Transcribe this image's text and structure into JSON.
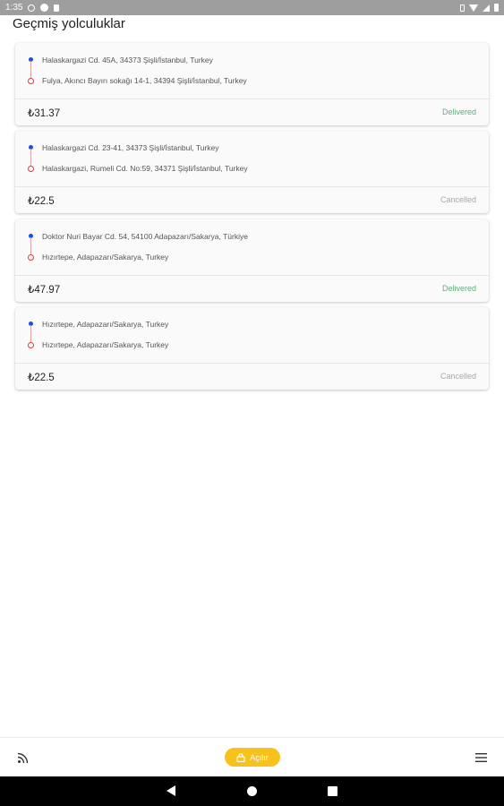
{
  "status_bar": {
    "time": "1:35"
  },
  "page": {
    "title": "Geçmiş yolculuklar"
  },
  "trips": [
    {
      "from": "Halaskargazi Cd. 45A, 34373 Şişli/İstanbul, Turkey",
      "to": "Fulya, Akıncı Bayırı sokağı 14-1, 34394 Şişli/İstanbul, Turkey",
      "price": "₺31.37",
      "status": "Delivered"
    },
    {
      "from": "Halaskargazi Cd. 23-41, 34373 Şişli/İstanbul, Turkey",
      "to": "Halaskargazi, Rumeli Cd. No:59, 34371 Şişli/İstanbul, Turkey",
      "price": "₺22.5",
      "status": "Cancelled"
    },
    {
      "from": "Doktor Nuri Bayar Cd. 54, 54100 Adapazarı/Sakarya, Türkiye",
      "to": "Hızırtepe, Adapazarı/Sakarya, Turkey",
      "price": "₺47.97",
      "status": "Delivered"
    },
    {
      "from": "Hızırtepe, Adapazarı/Sakarya, Turkey",
      "to": "Hızırtepe, Adapazarı/Sakarya, Turkey",
      "price": "₺22.5",
      "status": "Cancelled"
    }
  ],
  "bottom_bar": {
    "open_label": "Açılır",
    "left_icon": "feed-icon",
    "right_icon": "menu-icon",
    "accent_color": "#f7c21b"
  },
  "colors": {
    "delivered": "#5fae7d",
    "cancelled": "#a8a8a8",
    "origin_dot": "#1a4ee8",
    "destination_dot": "#e53935"
  }
}
